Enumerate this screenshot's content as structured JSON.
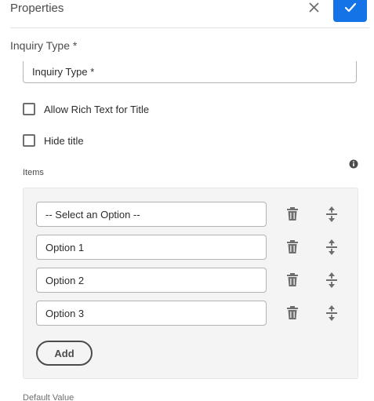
{
  "header": {
    "title": "Properties"
  },
  "form": {
    "section_title": "Inquiry Type *",
    "title_value": "Inquiry Type *",
    "checkboxes": [
      {
        "label": "Allow Rich Text for Title",
        "checked": false
      },
      {
        "label": "Hide title",
        "checked": false
      }
    ],
    "items_label": "Items",
    "items": [
      {
        "value": "-- Select an Option --"
      },
      {
        "value": "Option 1"
      },
      {
        "value": "Option 2"
      },
      {
        "value": "Option 3"
      }
    ],
    "add_label": "Add",
    "next_label_partial": "Default Value"
  },
  "colors": {
    "accent": "#1473e6",
    "panel_bg": "#f4f4f4"
  }
}
